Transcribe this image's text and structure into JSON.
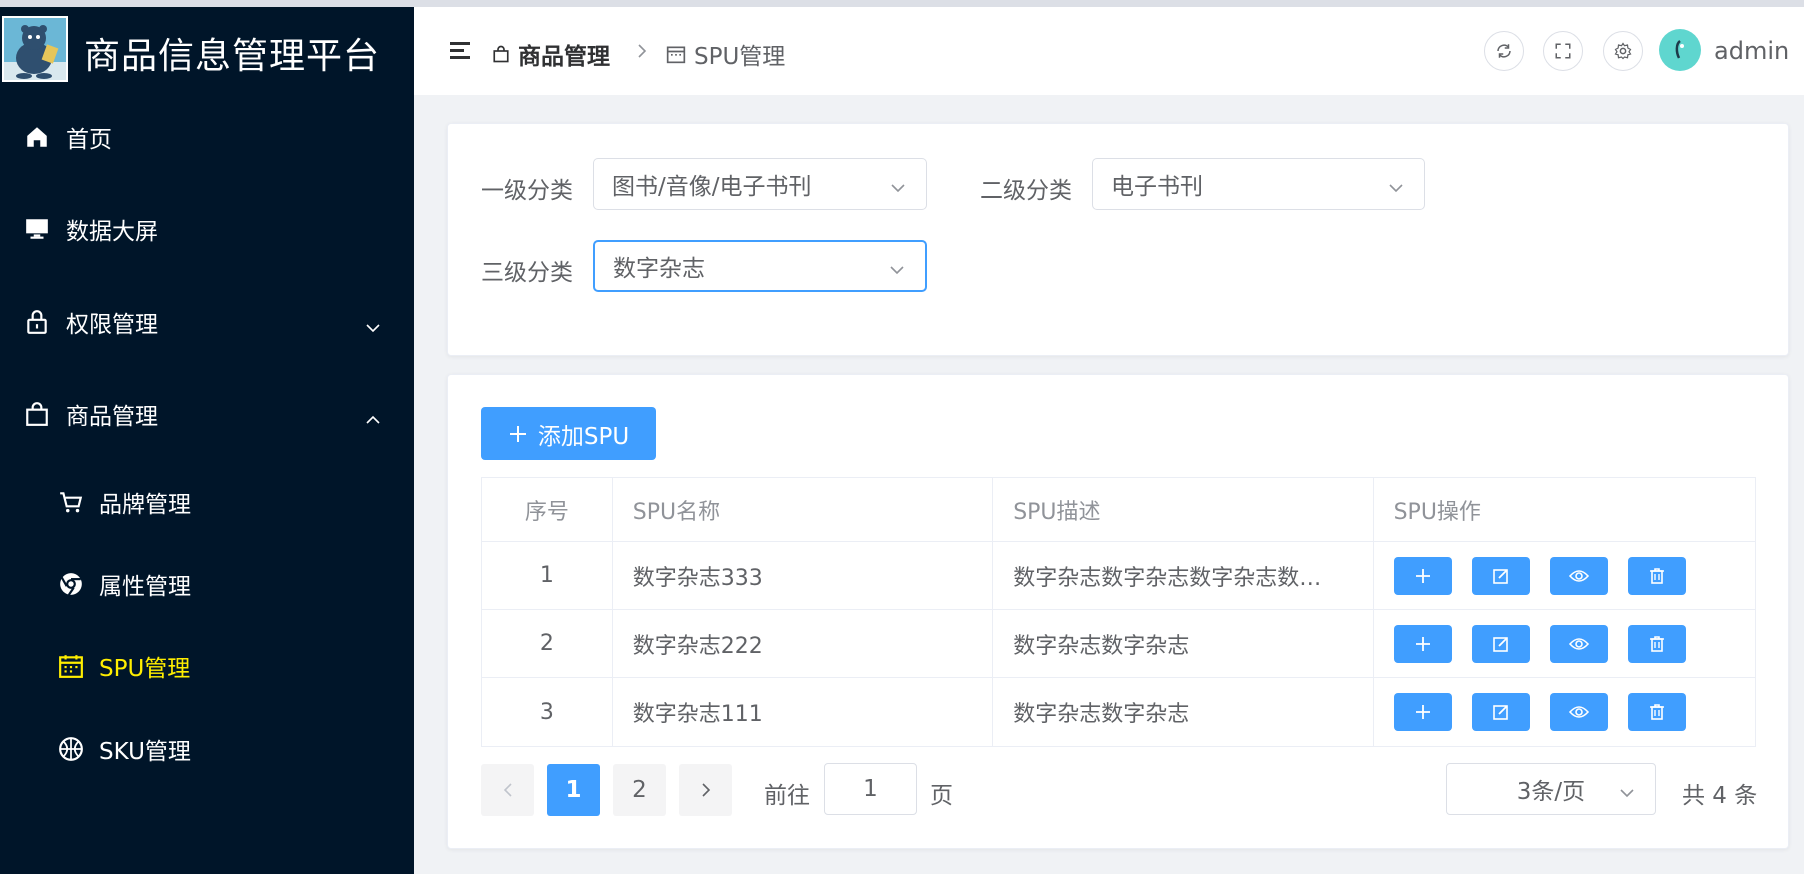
{
  "app": {
    "title": "商品信息管理平台"
  },
  "sidebar": {
    "items": [
      {
        "label": "首页",
        "icon": "home-icon"
      },
      {
        "label": "数据大屏",
        "icon": "monitor-icon"
      },
      {
        "label": "权限管理",
        "icon": "lock-icon"
      },
      {
        "label": "商品管理",
        "icon": "shopping-bag-icon"
      },
      {
        "label": "品牌管理",
        "icon": "cart-icon"
      },
      {
        "label": "属性管理",
        "icon": "chrome-icon"
      },
      {
        "label": "SPU管理",
        "icon": "calendar-icon",
        "active": true
      },
      {
        "label": "SKU管理",
        "icon": "basketball-icon"
      }
    ]
  },
  "header": {
    "breadcrumb": [
      "商品管理",
      "SPU管理"
    ],
    "username": "admin"
  },
  "filters": {
    "level1": {
      "label": "一级分类",
      "value": "图书/音像/电子书刊"
    },
    "level2": {
      "label": "二级分类",
      "value": "电子书刊"
    },
    "level3": {
      "label": "三级分类",
      "value": "数字杂志"
    }
  },
  "toolbar": {
    "add_label": "添加SPU"
  },
  "table": {
    "headers": [
      "序号",
      "SPU名称",
      "SPU描述",
      "SPU操作"
    ],
    "rows": [
      {
        "index": "1",
        "name": "数字杂志333",
        "desc": "数字杂志数字杂志数字杂志数字杂志"
      },
      {
        "index": "2",
        "name": "数字杂志222",
        "desc": "数字杂志数字杂志"
      },
      {
        "index": "3",
        "name": "数字杂志111",
        "desc": "数字杂志数字杂志"
      }
    ]
  },
  "pagination": {
    "pages": [
      "1",
      "2"
    ],
    "current": "1",
    "goto_prefix": "前往",
    "goto_value": "1",
    "goto_suffix": "页",
    "page_size": "3条/页",
    "total": "共 4 条"
  },
  "colors": {
    "sidebar_bg": "#001529",
    "primary": "#409eff",
    "active_menu": "#ffee00"
  }
}
